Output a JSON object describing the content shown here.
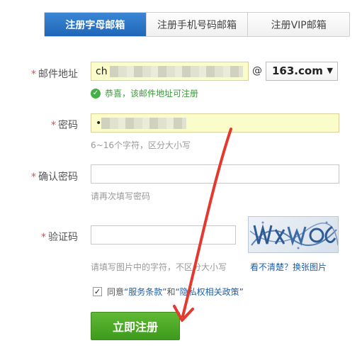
{
  "tabs": [
    {
      "label": "注册字母邮箱",
      "active": true
    },
    {
      "label": "注册手机号码邮箱",
      "active": false
    },
    {
      "label": "注册VIP邮箱",
      "active": false
    }
  ],
  "email": {
    "required_mark": "*",
    "label": "邮件地址",
    "value_prefix": "ch",
    "at": "@",
    "domain": "163.com",
    "success": "恭喜，该邮件地址可注册"
  },
  "password": {
    "required_mark": "*",
    "label": "密码",
    "value_prefix": "•",
    "hint": "6~16个字符，区分大小写"
  },
  "confirm": {
    "required_mark": "*",
    "label": "确认密码",
    "value": "",
    "hint": "请再次填写密码"
  },
  "captcha": {
    "required_mark": "*",
    "label": "验证码",
    "value": "",
    "hint": "请填写图片中的字符，不区分大小写",
    "refresh_link": "看不清楚？换张图片"
  },
  "agreement": {
    "checked": true,
    "prefix": "同意",
    "terms": "“服务条款”",
    "and": "和",
    "privacy": "“隐私权相关政策”"
  },
  "submit": {
    "label": "立即注册"
  },
  "colors": {
    "tab_active": "#1f66b8",
    "submit": "#4aa826",
    "annotation_arrow": "#e23a2e",
    "required": "#d9534f",
    "link": "#1f5fa8"
  }
}
